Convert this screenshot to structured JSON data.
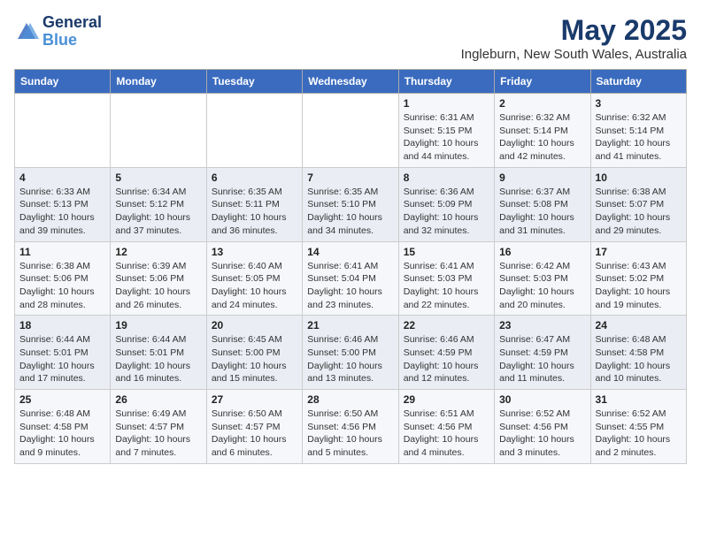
{
  "header": {
    "logo_line1": "General",
    "logo_line2": "Blue",
    "title": "May 2025",
    "subtitle": "Ingleburn, New South Wales, Australia"
  },
  "days_of_week": [
    "Sunday",
    "Monday",
    "Tuesday",
    "Wednesday",
    "Thursday",
    "Friday",
    "Saturday"
  ],
  "weeks": [
    {
      "row_bg": "odd",
      "days": [
        {
          "num": "",
          "info": ""
        },
        {
          "num": "",
          "info": ""
        },
        {
          "num": "",
          "info": ""
        },
        {
          "num": "",
          "info": ""
        },
        {
          "num": "1",
          "info": "Sunrise: 6:31 AM\nSunset: 5:15 PM\nDaylight: 10 hours\nand 44 minutes."
        },
        {
          "num": "2",
          "info": "Sunrise: 6:32 AM\nSunset: 5:14 PM\nDaylight: 10 hours\nand 42 minutes."
        },
        {
          "num": "3",
          "info": "Sunrise: 6:32 AM\nSunset: 5:14 PM\nDaylight: 10 hours\nand 41 minutes."
        }
      ]
    },
    {
      "row_bg": "even",
      "days": [
        {
          "num": "4",
          "info": "Sunrise: 6:33 AM\nSunset: 5:13 PM\nDaylight: 10 hours\nand 39 minutes."
        },
        {
          "num": "5",
          "info": "Sunrise: 6:34 AM\nSunset: 5:12 PM\nDaylight: 10 hours\nand 37 minutes."
        },
        {
          "num": "6",
          "info": "Sunrise: 6:35 AM\nSunset: 5:11 PM\nDaylight: 10 hours\nand 36 minutes."
        },
        {
          "num": "7",
          "info": "Sunrise: 6:35 AM\nSunset: 5:10 PM\nDaylight: 10 hours\nand 34 minutes."
        },
        {
          "num": "8",
          "info": "Sunrise: 6:36 AM\nSunset: 5:09 PM\nDaylight: 10 hours\nand 32 minutes."
        },
        {
          "num": "9",
          "info": "Sunrise: 6:37 AM\nSunset: 5:08 PM\nDaylight: 10 hours\nand 31 minutes."
        },
        {
          "num": "10",
          "info": "Sunrise: 6:38 AM\nSunset: 5:07 PM\nDaylight: 10 hours\nand 29 minutes."
        }
      ]
    },
    {
      "row_bg": "odd",
      "days": [
        {
          "num": "11",
          "info": "Sunrise: 6:38 AM\nSunset: 5:06 PM\nDaylight: 10 hours\nand 28 minutes."
        },
        {
          "num": "12",
          "info": "Sunrise: 6:39 AM\nSunset: 5:06 PM\nDaylight: 10 hours\nand 26 minutes."
        },
        {
          "num": "13",
          "info": "Sunrise: 6:40 AM\nSunset: 5:05 PM\nDaylight: 10 hours\nand 24 minutes."
        },
        {
          "num": "14",
          "info": "Sunrise: 6:41 AM\nSunset: 5:04 PM\nDaylight: 10 hours\nand 23 minutes."
        },
        {
          "num": "15",
          "info": "Sunrise: 6:41 AM\nSunset: 5:03 PM\nDaylight: 10 hours\nand 22 minutes."
        },
        {
          "num": "16",
          "info": "Sunrise: 6:42 AM\nSunset: 5:03 PM\nDaylight: 10 hours\nand 20 minutes."
        },
        {
          "num": "17",
          "info": "Sunrise: 6:43 AM\nSunset: 5:02 PM\nDaylight: 10 hours\nand 19 minutes."
        }
      ]
    },
    {
      "row_bg": "even",
      "days": [
        {
          "num": "18",
          "info": "Sunrise: 6:44 AM\nSunset: 5:01 PM\nDaylight: 10 hours\nand 17 minutes."
        },
        {
          "num": "19",
          "info": "Sunrise: 6:44 AM\nSunset: 5:01 PM\nDaylight: 10 hours\nand 16 minutes."
        },
        {
          "num": "20",
          "info": "Sunrise: 6:45 AM\nSunset: 5:00 PM\nDaylight: 10 hours\nand 15 minutes."
        },
        {
          "num": "21",
          "info": "Sunrise: 6:46 AM\nSunset: 5:00 PM\nDaylight: 10 hours\nand 13 minutes."
        },
        {
          "num": "22",
          "info": "Sunrise: 6:46 AM\nSunset: 4:59 PM\nDaylight: 10 hours\nand 12 minutes."
        },
        {
          "num": "23",
          "info": "Sunrise: 6:47 AM\nSunset: 4:59 PM\nDaylight: 10 hours\nand 11 minutes."
        },
        {
          "num": "24",
          "info": "Sunrise: 6:48 AM\nSunset: 4:58 PM\nDaylight: 10 hours\nand 10 minutes."
        }
      ]
    },
    {
      "row_bg": "odd",
      "days": [
        {
          "num": "25",
          "info": "Sunrise: 6:48 AM\nSunset: 4:58 PM\nDaylight: 10 hours\nand 9 minutes."
        },
        {
          "num": "26",
          "info": "Sunrise: 6:49 AM\nSunset: 4:57 PM\nDaylight: 10 hours\nand 7 minutes."
        },
        {
          "num": "27",
          "info": "Sunrise: 6:50 AM\nSunset: 4:57 PM\nDaylight: 10 hours\nand 6 minutes."
        },
        {
          "num": "28",
          "info": "Sunrise: 6:50 AM\nSunset: 4:56 PM\nDaylight: 10 hours\nand 5 minutes."
        },
        {
          "num": "29",
          "info": "Sunrise: 6:51 AM\nSunset: 4:56 PM\nDaylight: 10 hours\nand 4 minutes."
        },
        {
          "num": "30",
          "info": "Sunrise: 6:52 AM\nSunset: 4:56 PM\nDaylight: 10 hours\nand 3 minutes."
        },
        {
          "num": "31",
          "info": "Sunrise: 6:52 AM\nSunset: 4:55 PM\nDaylight: 10 hours\nand 2 minutes."
        }
      ]
    }
  ]
}
